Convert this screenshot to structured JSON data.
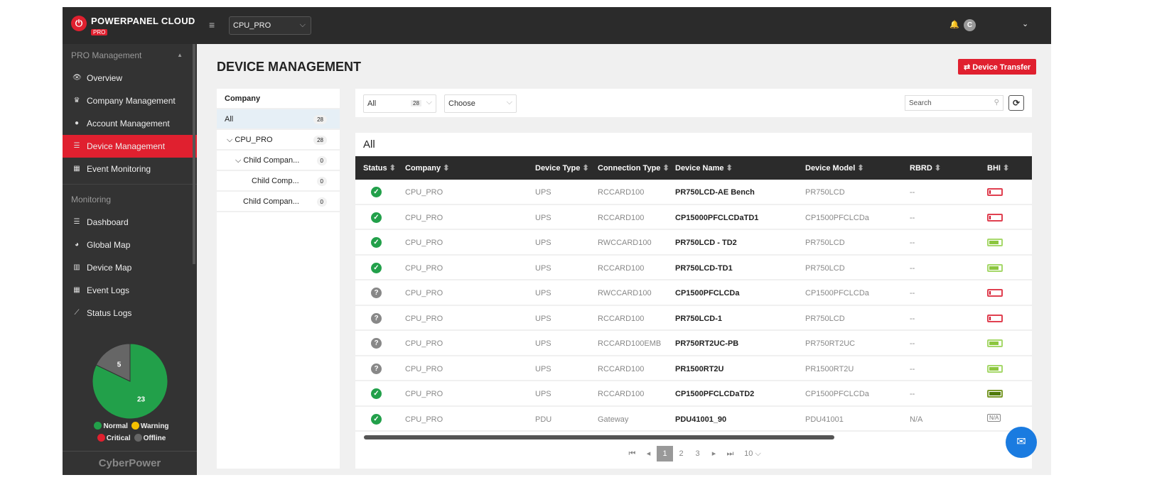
{
  "header": {
    "brand": "POWERPANEL CLOUD",
    "badge": "PRO",
    "company_select": "CPU_PRO",
    "avatar_initial": "C"
  },
  "sidebar": {
    "section1": "PRO Management",
    "items1": [
      {
        "label": "Overview",
        "icon": "eye-icon",
        "glyph": "👁"
      },
      {
        "label": "Company Management",
        "icon": "trophy-icon",
        "glyph": "♛"
      },
      {
        "label": "Account Management",
        "icon": "user-icon",
        "glyph": "●"
      },
      {
        "label": "Device Management",
        "icon": "table-icon",
        "glyph": "☰"
      },
      {
        "label": "Event Monitoring",
        "icon": "grid-icon",
        "glyph": "▦"
      }
    ],
    "section2": "Monitoring",
    "items2": [
      {
        "label": "Dashboard",
        "icon": "table-icon",
        "glyph": "☰"
      },
      {
        "label": "Global Map",
        "icon": "globe-icon",
        "glyph": "◕"
      },
      {
        "label": "Device Map",
        "icon": "map-icon",
        "glyph": "▥"
      },
      {
        "label": "Event Logs",
        "icon": "grid-icon",
        "glyph": "▦"
      },
      {
        "label": "Status Logs",
        "icon": "line-chart-icon",
        "glyph": "⟋"
      }
    ],
    "brand": "CyberPower"
  },
  "chart_data": {
    "type": "pie",
    "categories": [
      "Normal",
      "Offline"
    ],
    "values": [
      23,
      5
    ],
    "legend": [
      "Normal",
      "Warning",
      "Critical",
      "Offline"
    ],
    "colors": {
      "Normal": "#22a04a",
      "Warning": "#f5c000",
      "Critical": "#e0202f",
      "Offline": "#666666"
    }
  },
  "page": {
    "title": "DEVICE MANAGEMENT",
    "transfer": "Device Transfer"
  },
  "tree": {
    "header": "Company",
    "items": [
      {
        "label": "All",
        "count": "28"
      },
      {
        "label": "CPU_PRO",
        "count": "28"
      },
      {
        "label": "Child Compan...",
        "count": "0"
      },
      {
        "label": "Child Comp...",
        "count": "0"
      },
      {
        "label": "Child Compan...",
        "count": "0"
      }
    ]
  },
  "filters": {
    "type": "All",
    "type_count": "28",
    "choose": "Choose",
    "search_placeholder": "Search"
  },
  "table": {
    "title": "All",
    "columns": [
      "Status",
      "Company",
      "Device Type",
      "Connection Type",
      "Device Name",
      "Device Model",
      "RBRD",
      "BHI"
    ],
    "rows": [
      {
        "status": "normal",
        "company": "CPU_PRO",
        "type": "UPS",
        "conn": "RCCARD100",
        "name": "PR750LCD-AE Bench",
        "model": "PR750LCD",
        "rbrd": "--",
        "bhi": "low"
      },
      {
        "status": "normal",
        "company": "CPU_PRO",
        "type": "UPS",
        "conn": "RCCARD100",
        "name": "CP15000PFCLCDaTD1",
        "model": "CP1500PFCLCDa",
        "rbrd": "--",
        "bhi": "low"
      },
      {
        "status": "normal",
        "company": "CPU_PRO",
        "type": "UPS",
        "conn": "RWCCARD100",
        "name": "PR750LCD - TD2",
        "model": "PR750LCD",
        "rbrd": "--",
        "bhi": "good"
      },
      {
        "status": "normal",
        "company": "CPU_PRO",
        "type": "UPS",
        "conn": "RCCARD100",
        "name": "PR750LCD-TD1",
        "model": "PR750LCD",
        "rbrd": "--",
        "bhi": "good"
      },
      {
        "status": "offline",
        "company": "CPU_PRO",
        "type": "UPS",
        "conn": "RWCCARD100",
        "name": "CP1500PFCLCDa",
        "model": "CP1500PFCLCDa",
        "rbrd": "--",
        "bhi": "low"
      },
      {
        "status": "offline",
        "company": "CPU_PRO",
        "type": "UPS",
        "conn": "RCCARD100",
        "name": "PR750LCD-1",
        "model": "PR750LCD",
        "rbrd": "--",
        "bhi": "low"
      },
      {
        "status": "offline",
        "company": "CPU_PRO",
        "type": "UPS",
        "conn": "RCCARD100EMB",
        "name": "PR750RT2UC-PB",
        "model": "PR750RT2UC",
        "rbrd": "--",
        "bhi": "good"
      },
      {
        "status": "offline",
        "company": "CPU_PRO",
        "type": "UPS",
        "conn": "RCCARD100",
        "name": "PR1500RT2U",
        "model": "PR1500RT2U",
        "rbrd": "--",
        "bhi": "good"
      },
      {
        "status": "normal",
        "company": "CPU_PRO",
        "type": "UPS",
        "conn": "RCCARD100",
        "name": "CP1500PFCLCDaTD2",
        "model": "CP1500PFCLCDa",
        "rbrd": "--",
        "bhi": "full"
      },
      {
        "status": "normal",
        "company": "CPU_PRO",
        "type": "PDU",
        "conn": "Gateway",
        "name": "PDU41001_90",
        "model": "PDU41001",
        "rbrd": "N/A",
        "bhi": "na",
        "bhi_text": "N/A"
      }
    ]
  },
  "pagination": {
    "pages": [
      "1",
      "2",
      "3"
    ],
    "current": "1",
    "page_size": "10"
  }
}
